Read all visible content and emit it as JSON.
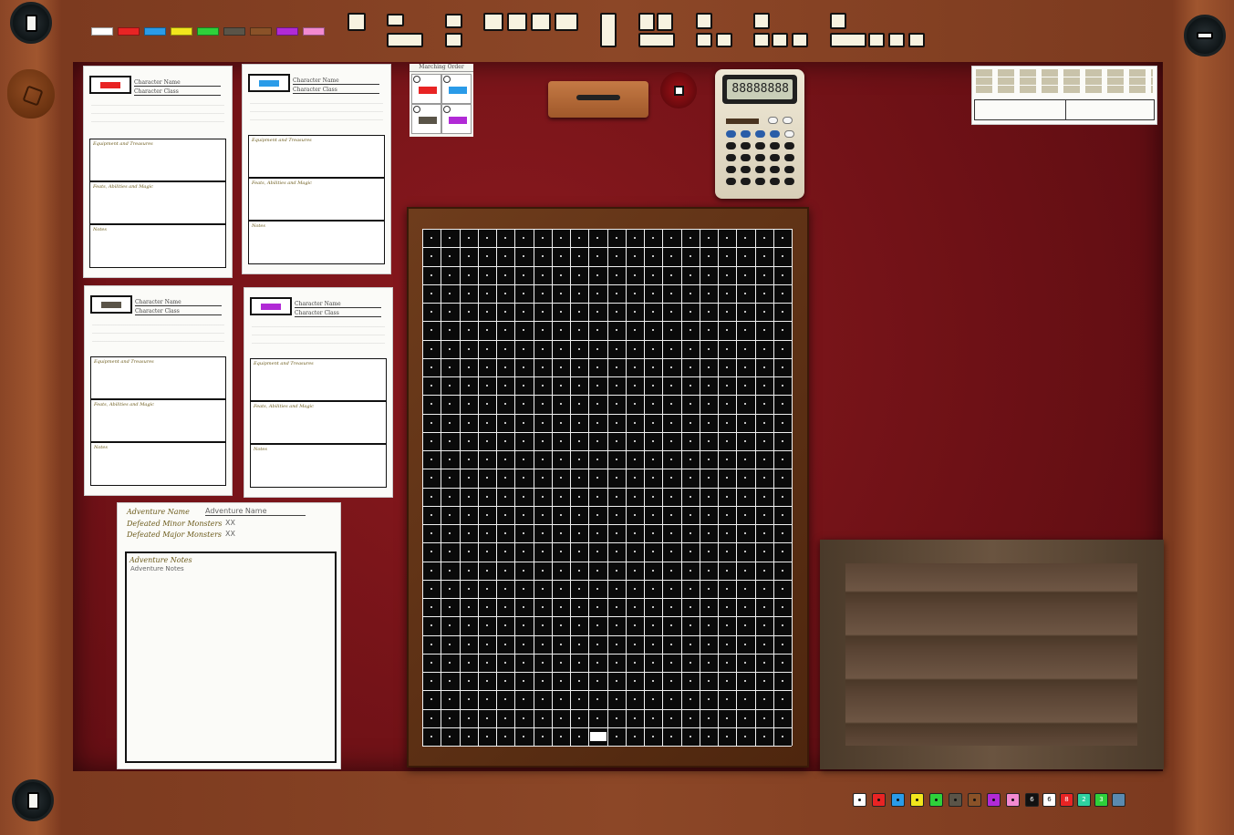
{
  "colors": {
    "felt": "#7a1418",
    "frame": "#8a4526",
    "grid": "#0a0a0a",
    "players": [
      "#ffffff",
      "#e82424",
      "#2a9be8",
      "#f2e61c",
      "#2ed13a",
      "#5a5448",
      "#8a5228",
      "#b12ad6",
      "#f28ad0"
    ]
  },
  "seats": {
    "top_left": "player-seat",
    "top_right": "player-seat",
    "bottom_left": "player-seat"
  },
  "character_sheets": [
    {
      "color": "#e82424",
      "name": "Character Name",
      "class": "Character Class",
      "equipment": "Equipment and Treasures",
      "feats": "Feats, Abilities and Magic",
      "notes": "Notes"
    },
    {
      "color": "#2a9be8",
      "name": "Character Name",
      "class": "Character Class",
      "equipment": "Equipment and Treasures",
      "feats": "Feats, Abilities and Magic",
      "notes": "Notes"
    },
    {
      "color": "#5a5448",
      "name": "Character Name",
      "class": "Character Class",
      "equipment": "Equipment and Treasures",
      "feats": "Feats, Abilities and Magic",
      "notes": "Notes"
    },
    {
      "color": "#b12ad6",
      "name": "Character Name",
      "class": "Character Class",
      "equipment": "Equipment and Treasures",
      "feats": "Feats, Abilities and Magic",
      "notes": "Notes"
    }
  ],
  "adventure": {
    "name_label": "Adventure Name",
    "name_value": "Adventure Name",
    "minor_label": "Defeated Minor Monsters",
    "minor_value": "XX",
    "major_label": "Defeated Major Monsters",
    "major_value": "XX",
    "notes_label": "Adventure Notes",
    "notes_value": "Adventure Notes"
  },
  "turn_order": {
    "title": "Marching Order",
    "colors": [
      "#e82424",
      "#2a9be8",
      "#5a5448",
      "#b12ad6"
    ]
  },
  "calculator": {
    "display": "88888888"
  },
  "dice": {
    "colors": [
      "#ffffff",
      "#e82424",
      "#2a9be8",
      "#f2e61c",
      "#2ed13a",
      "#5a5448",
      "#8a5228",
      "#b12ad6",
      "#f28ad0"
    ],
    "special": [
      {
        "label": "6",
        "color": "#111111"
      },
      {
        "label": "6",
        "color": "#ffffff"
      },
      {
        "label": "8",
        "color": "#e82424"
      },
      {
        "label": "2",
        "color": "#2ed1a0"
      },
      {
        "label": "3",
        "color": "#2ed13a"
      },
      {
        "label": "",
        "color": "#5a8ab0"
      }
    ]
  },
  "board": {
    "cols": 20,
    "rows": 28
  }
}
